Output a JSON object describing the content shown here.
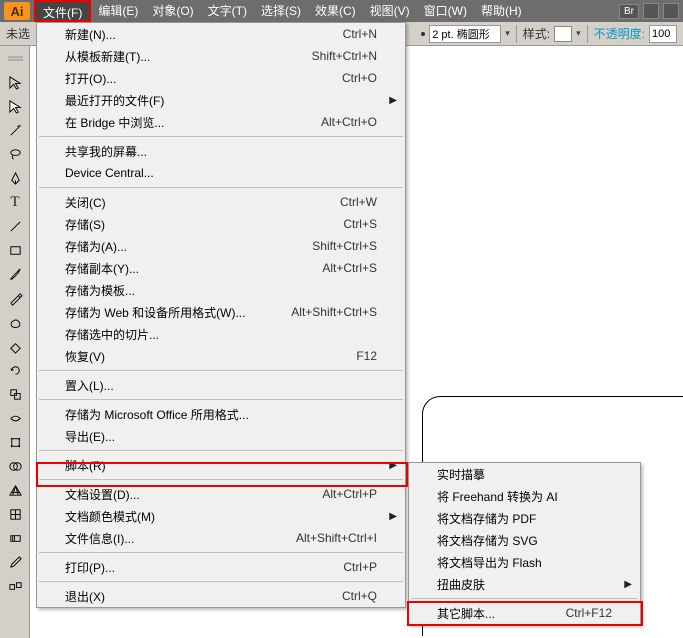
{
  "menubar": {
    "items": [
      {
        "label": "文件(F)"
      },
      {
        "label": "编辑(E)"
      },
      {
        "label": "对象(O)"
      },
      {
        "label": "文字(T)"
      },
      {
        "label": "选择(S)"
      },
      {
        "label": "效果(C)"
      },
      {
        "label": "视图(V)"
      },
      {
        "label": "窗口(W)"
      },
      {
        "label": "帮助(H)"
      }
    ],
    "br_label": "Br"
  },
  "options": {
    "left": "未选",
    "stroke_value": "2 pt. 椭圆形",
    "style_label": "样式:",
    "opacity_label": "不透明度:",
    "opacity_value": "100"
  },
  "file_menu": [
    {
      "type": "item",
      "label": "新建(N)...",
      "shortcut": "Ctrl+N"
    },
    {
      "type": "item",
      "label": "从模板新建(T)...",
      "shortcut": "Shift+Ctrl+N"
    },
    {
      "type": "item",
      "label": "打开(O)...",
      "shortcut": "Ctrl+O"
    },
    {
      "type": "item",
      "label": "最近打开的文件(F)",
      "shortcut": "",
      "arrow": true
    },
    {
      "type": "item",
      "label": "在 Bridge 中浏览...",
      "shortcut": "Alt+Ctrl+O"
    },
    {
      "type": "sep"
    },
    {
      "type": "item",
      "label": "共享我的屏幕...",
      "shortcut": ""
    },
    {
      "type": "item",
      "label": "Device Central...",
      "shortcut": ""
    },
    {
      "type": "sep"
    },
    {
      "type": "item",
      "label": "关闭(C)",
      "shortcut": "Ctrl+W"
    },
    {
      "type": "item",
      "label": "存储(S)",
      "shortcut": "Ctrl+S"
    },
    {
      "type": "item",
      "label": "存储为(A)...",
      "shortcut": "Shift+Ctrl+S"
    },
    {
      "type": "item",
      "label": "存储副本(Y)...",
      "shortcut": "Alt+Ctrl+S"
    },
    {
      "type": "item",
      "label": "存储为模板...",
      "shortcut": ""
    },
    {
      "type": "item",
      "label": "存储为 Web 和设备所用格式(W)...",
      "shortcut": "Alt+Shift+Ctrl+S"
    },
    {
      "type": "item",
      "label": "存储选中的切片...",
      "shortcut": ""
    },
    {
      "type": "item",
      "label": "恢复(V)",
      "shortcut": "F12"
    },
    {
      "type": "sep"
    },
    {
      "type": "item",
      "label": "置入(L)...",
      "shortcut": ""
    },
    {
      "type": "sep"
    },
    {
      "type": "item",
      "label": "存储为 Microsoft Office 所用格式...",
      "shortcut": ""
    },
    {
      "type": "item",
      "label": "导出(E)...",
      "shortcut": ""
    },
    {
      "type": "sep"
    },
    {
      "type": "item",
      "label": "脚本(R)",
      "shortcut": "",
      "arrow": true,
      "highlight": true
    },
    {
      "type": "sep"
    },
    {
      "type": "item",
      "label": "文档设置(D)...",
      "shortcut": "Alt+Ctrl+P"
    },
    {
      "type": "item",
      "label": "文档颜色模式(M)",
      "shortcut": "",
      "arrow": true
    },
    {
      "type": "item",
      "label": "文件信息(I)...",
      "shortcut": "Alt+Shift+Ctrl+I"
    },
    {
      "type": "sep"
    },
    {
      "type": "item",
      "label": "打印(P)...",
      "shortcut": "Ctrl+P"
    },
    {
      "type": "sep"
    },
    {
      "type": "item",
      "label": "退出(X)",
      "shortcut": "Ctrl+Q"
    }
  ],
  "submenu": [
    {
      "type": "item",
      "label": "实时描摹",
      "shortcut": ""
    },
    {
      "type": "item",
      "label": "将 Freehand 转换为 AI",
      "shortcut": ""
    },
    {
      "type": "item",
      "label": "将文档存储为 PDF",
      "shortcut": ""
    },
    {
      "type": "item",
      "label": "将文档存储为 SVG",
      "shortcut": ""
    },
    {
      "type": "item",
      "label": "将文档导出为 Flash",
      "shortcut": ""
    },
    {
      "type": "item",
      "label": "扭曲皮肤",
      "shortcut": "",
      "arrow": true
    },
    {
      "type": "sep"
    },
    {
      "type": "item",
      "label": "其它脚本...",
      "shortcut": "Ctrl+F12",
      "highlight": true
    }
  ]
}
